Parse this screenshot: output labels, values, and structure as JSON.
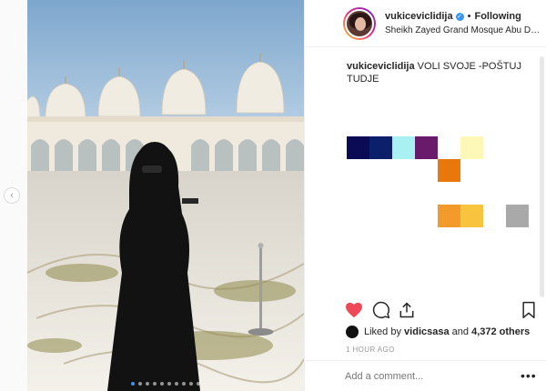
{
  "post": {
    "username": "vukiceviclidija",
    "follow_label": "Following",
    "separator": "•",
    "location": "Sheikh Zayed Grand Mosque Abu Dhabi, U...",
    "caption_user": "vukiceviclidija",
    "caption_text": "VOLI SVOJE -POŠTUJ TUDJE",
    "liked_by_prefix": "Liked by",
    "liked_by_user": "vidicsasa",
    "liked_by_conj": "and",
    "likes_count": "4,372 others",
    "timestamp": "1 HOUR AGO",
    "comment_placeholder": "Add a comment...",
    "more_label": "•••"
  },
  "carousel": {
    "slide_count": 10,
    "active_slide": 0,
    "prev_glyph": "‹",
    "next_glyph": "›"
  },
  "emoji_blocks": [
    {
      "row": 0,
      "col": 0,
      "color": "#0b0b55"
    },
    {
      "row": 0,
      "col": 1,
      "color": "#0b1f6b"
    },
    {
      "row": 0,
      "col": 2,
      "color": "#a9f0f2"
    },
    {
      "row": 0,
      "col": 3,
      "color": "#6a1a6b"
    },
    {
      "row": 0,
      "col": 5,
      "color": "#fdf7b8"
    },
    {
      "row": 1,
      "col": 4,
      "color": "#e8770c"
    },
    {
      "row": 3,
      "col": 4,
      "color": "#f39a2c"
    },
    {
      "row": 3,
      "col": 5,
      "color": "#f8c440"
    },
    {
      "row": 3,
      "col": 7,
      "color": "#a9a9a9"
    }
  ],
  "colors": {
    "like": "#ed4956",
    "verified": "#3897f0",
    "muted": "#999999"
  },
  "icons": [
    "heart-icon",
    "comment-icon",
    "share-icon",
    "bookmark-icon",
    "verified-icon"
  ]
}
